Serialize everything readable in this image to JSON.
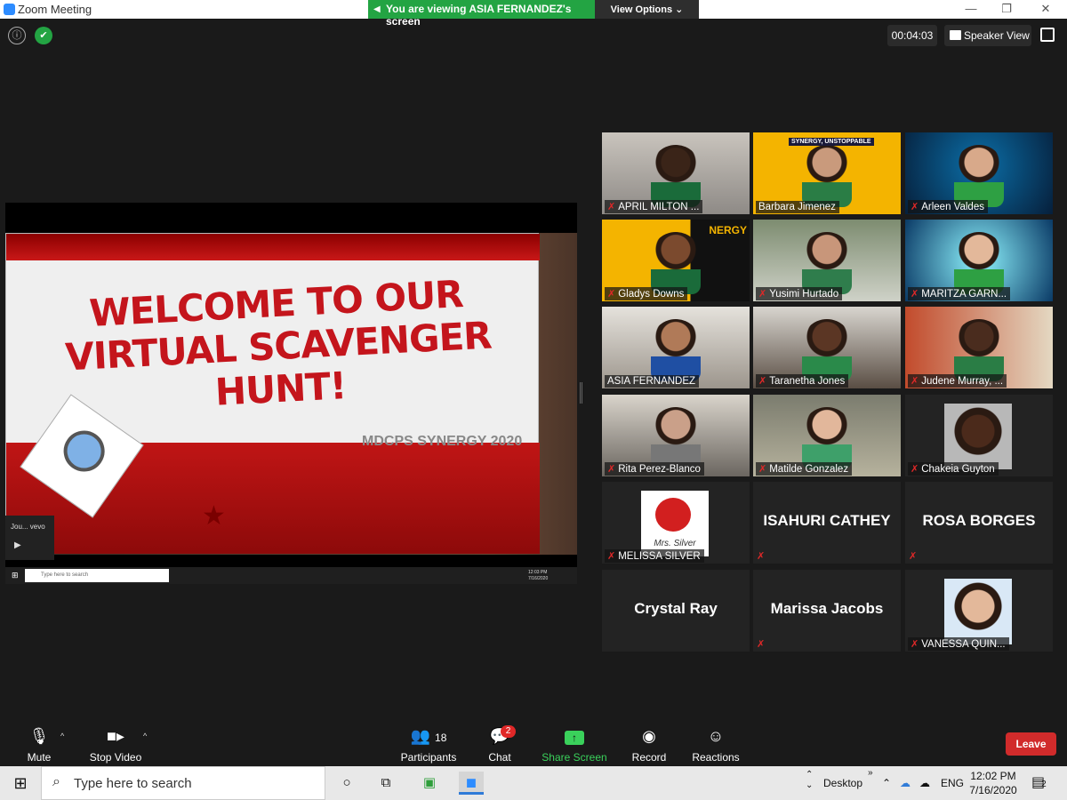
{
  "window": {
    "title": "Zoom Meeting",
    "viewing_banner": "You are viewing ASIA FERNANDEZ's screen",
    "view_options": "View Options ⌄",
    "minimize": "—",
    "maximize": "❐",
    "close": "✕"
  },
  "top": {
    "info_icon": "ⓘ",
    "shield_icon": "✔",
    "timer": "00:04:03",
    "speaker_view": "Speaker View"
  },
  "shared_screen": {
    "slide_title": "WELCOME TO OUR VIRTUAL SCAVENGER HUNT!",
    "slide_subtitle": "MDCPS SYNERGY 2020",
    "video_thumb": "Jou... vevo",
    "taskbar_search": "Type here to search",
    "taskbar_time": "12:03 PM",
    "taskbar_date": "7/16/2020"
  },
  "gallery": {
    "tiles": [
      {
        "name": "APRIL MILTON ...",
        "muted": true
      },
      {
        "name": "Barbara Jimenez",
        "muted": false
      },
      {
        "name": "Arleen Valdes",
        "muted": true
      },
      {
        "name": "Gladys Downs",
        "muted": true
      },
      {
        "name": "Yusimi Hurtado",
        "muted": true
      },
      {
        "name": "MARITZA GARN...",
        "muted": true
      },
      {
        "name": "ASIA FERNANDEZ",
        "muted": false
      },
      {
        "name": "Taranetha Jones",
        "muted": true
      },
      {
        "name": "Judene Murray, ...",
        "muted": true
      },
      {
        "name": "Rita Perez-Blanco",
        "muted": true
      },
      {
        "name": "Matilde Gonzalez",
        "muted": true
      },
      {
        "name": "Chakeia Guyton",
        "muted": true
      },
      {
        "name": "MELISSA SILVER",
        "muted": true
      },
      {
        "name": "ISAHURI CATHEY",
        "muted": true
      },
      {
        "name": "ROSA BORGES",
        "muted": true
      },
      {
        "name": "Crystal Ray",
        "muted": false
      },
      {
        "name": "Marissa Jacobs",
        "muted": true
      },
      {
        "name": "VANESSA QUIN...",
        "muted": true
      }
    ],
    "barbara_banner": "SYNERGY, UNSTOPPABLE",
    "gladys_banner": "NERGY",
    "melissa_sign": "Mrs. Silver",
    "mic_off_icon": "✗"
  },
  "toolbar": {
    "mute": "Mute",
    "stop_video": "Stop Video",
    "participants": "Participants",
    "participants_count": "18",
    "chat": "Chat",
    "chat_badge": "2",
    "share_screen": "Share Screen",
    "record": "Record",
    "reactions": "Reactions",
    "leave": "Leave",
    "caret": "^"
  },
  "taskbar": {
    "search_placeholder": "Type here to search",
    "desktop": "Desktop",
    "lang": "ENG",
    "time": "12:02 PM",
    "date": "7/16/2020",
    "notifications": "2"
  },
  "colors": {
    "zoom_blue": "#2d8cff",
    "share_green": "#23a443",
    "leave_red": "#d12b2b",
    "active_speaker": "#d7f266"
  }
}
